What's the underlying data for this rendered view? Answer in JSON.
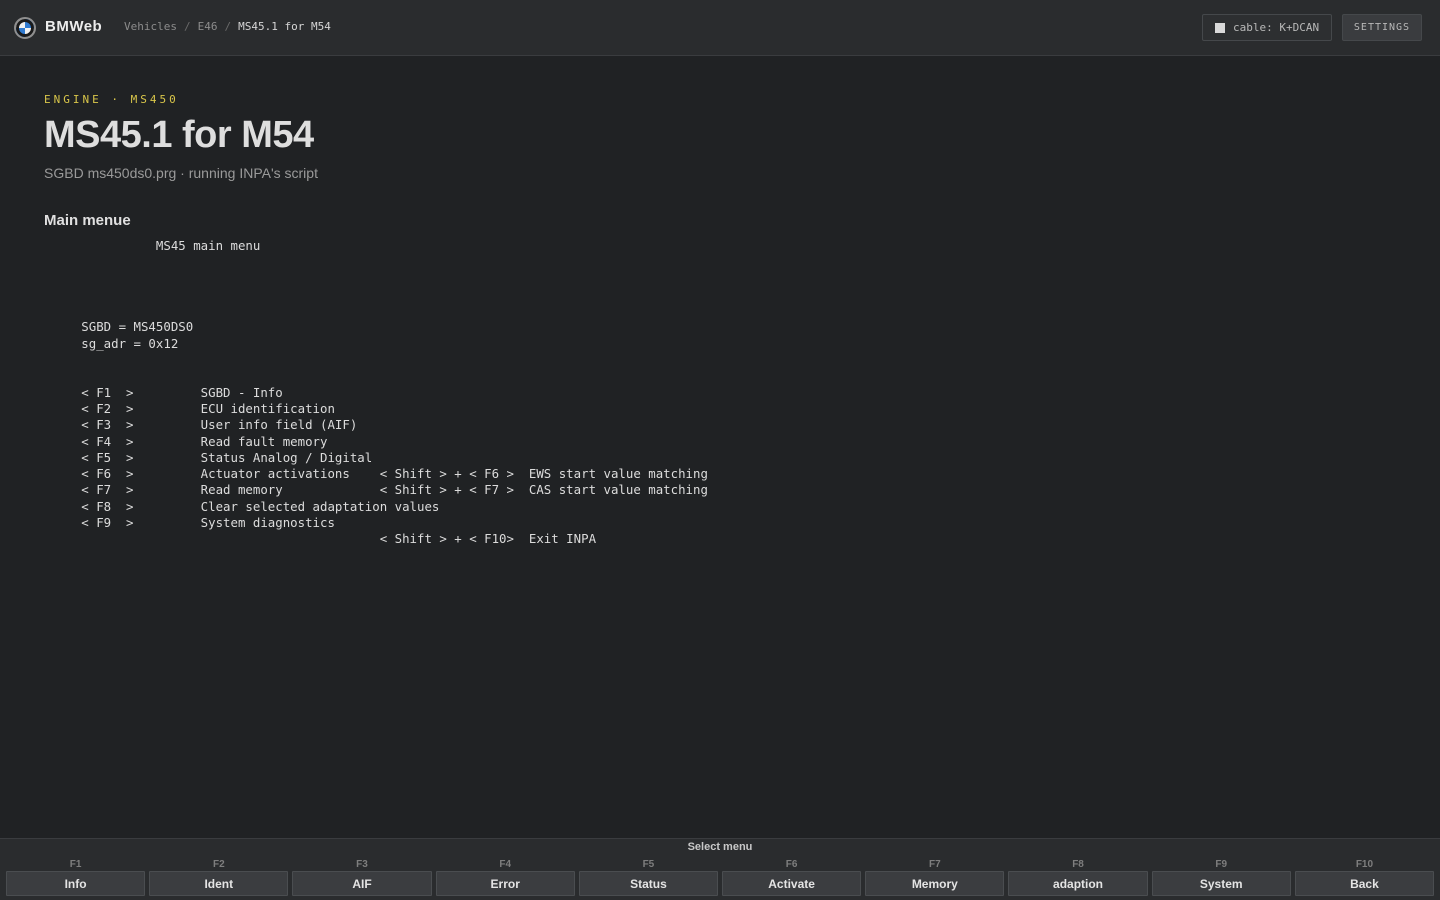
{
  "header": {
    "brand": "BMWeb",
    "breadcrumb": [
      "Vehicles",
      "E46",
      "MS45.1 for M54"
    ],
    "cable_label": "cable: K+DCAN",
    "settings_label": "SETTINGS"
  },
  "main": {
    "eyebrow": "ENGINE · MS450",
    "title": "MS45.1 for M54",
    "subtitle": "SGBD ms450ds0.prg · running INPA's script",
    "section_heading": "Main menue",
    "screen_text": "               MS45 main menu\n\n\n\n\n     SGBD = MS450DS0\n     sg_adr = 0x12\n\n\n     < F1  >         SGBD - Info\n     < F2  >         ECU identification\n     < F3  >         User info field (AIF)\n     < F4  >         Read fault memory\n     < F5  >         Status Analog / Digital\n     < F6  >         Actuator activations    < Shift > + < F6 >  EWS start value matching\n     < F7  >         Read memory             < Shift > + < F7 >  CAS start value matching\n     < F8  >         Clear selected adaptation values\n     < F9  >         System diagnostics\n                                             < Shift > + < F10>  Exit INPA"
  },
  "footer": {
    "caption": "Select menu",
    "keys": [
      {
        "key": "F1",
        "label": "Info"
      },
      {
        "key": "F2",
        "label": "Ident"
      },
      {
        "key": "F3",
        "label": "AIF"
      },
      {
        "key": "F4",
        "label": "Error"
      },
      {
        "key": "F5",
        "label": "Status"
      },
      {
        "key": "F6",
        "label": "Activate"
      },
      {
        "key": "F7",
        "label": "Memory"
      },
      {
        "key": "F8",
        "label": "adaption"
      },
      {
        "key": "F9",
        "label": "System"
      },
      {
        "key": "F10",
        "label": "Back"
      }
    ]
  },
  "colors": {
    "background": "#202224",
    "bar": "#2a2c2e",
    "accent": "#d9c64a",
    "text": "#dcdcdc"
  },
  "icons": {
    "logo": "bmw-roundel-icon",
    "cable_status": "status-square-icon"
  }
}
